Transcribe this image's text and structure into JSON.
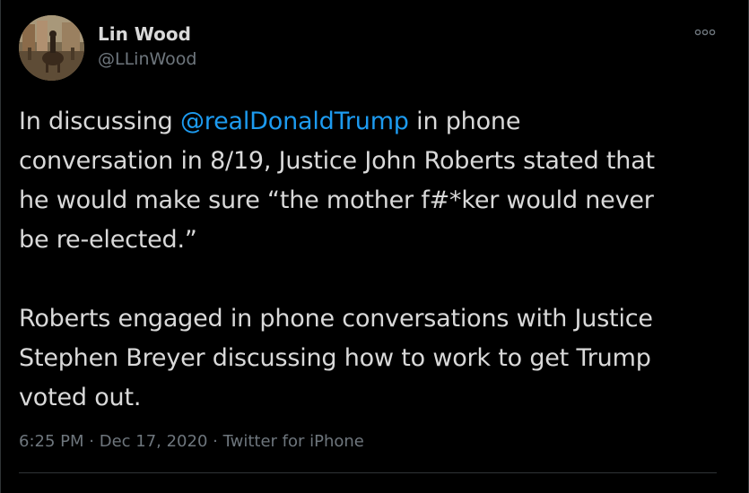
{
  "author": {
    "display_name": "Lin Wood",
    "handle": "@LLinWood"
  },
  "more_icon": "more-horizontal-icon",
  "tweet": {
    "line1_prefix": "In discussing ",
    "mention": "@realDonaldTrump",
    "line1_suffix": " in phone\nconversation in 8/19, Justice John Roberts stated that\nhe would make sure “the mother f#*ker would never\nbe re-elected.”\n\nRoberts engaged in phone conversations with Justice\nStephen Breyer discussing how to work to get Trump\nvoted out."
  },
  "meta": {
    "time": "6:25 PM",
    "separator1": " · ",
    "date": "Dec 17, 2020",
    "separator2": " · ",
    "source": "Twitter for iPhone"
  },
  "colors": {
    "background": "#000000",
    "text": "#d9d9d9",
    "secondary": "#6e767d",
    "link": "#1d9bf0",
    "divider": "#2f3336"
  }
}
